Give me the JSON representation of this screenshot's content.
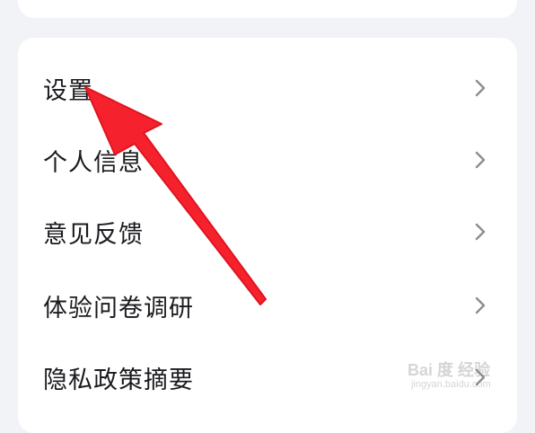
{
  "menu": {
    "items": [
      {
        "label": "设置",
        "icon": "chevron-right-icon"
      },
      {
        "label": "个人信息",
        "icon": "chevron-right-icon"
      },
      {
        "label": "意见反馈",
        "icon": "chevron-right-icon"
      },
      {
        "label": "体验问卷调研",
        "icon": "chevron-right-icon"
      },
      {
        "label": "隐私政策摘要",
        "icon": "chevron-right-icon"
      }
    ]
  },
  "annotation": {
    "arrow_color": "#f5222d",
    "arrow_target": "设置"
  },
  "watermark": {
    "brand": "Bai 度 经验",
    "domain": "jingyan.baidu.com"
  },
  "colors": {
    "background": "#f2f3f6",
    "card": "#ffffff",
    "text": "#1b1b1f",
    "chevron": "#8c8c94"
  }
}
